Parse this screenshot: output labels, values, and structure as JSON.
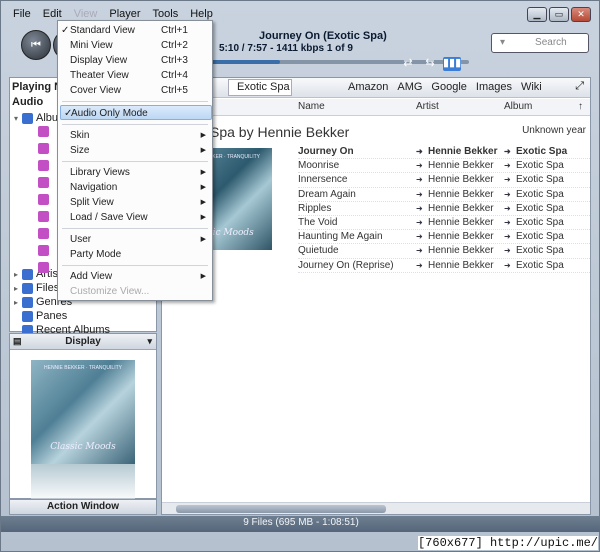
{
  "menubar": {
    "items": [
      "File",
      "Edit",
      "View",
      "Player",
      "Tools",
      "Help"
    ]
  },
  "player": {
    "track": "Journey On (Exotic Spa)",
    "info": "5:10 / 7:57 - 1411 kbps   1 of 9",
    "progress": 0.3
  },
  "search": {
    "placeholder": "Search"
  },
  "left": {
    "playing": "Playing Now",
    "audio": "Audio",
    "tree": [
      "Albums",
      "Artists",
      "Files",
      "Genres",
      "Panes",
      "Recent Albums"
    ]
  },
  "display": {
    "title": "Display"
  },
  "action": {
    "title": "Action Window"
  },
  "toolbar": {
    "combo": "Exotic Spa",
    "links": [
      "Amazon",
      "AMG",
      "Google",
      "Images",
      "Wiki"
    ]
  },
  "columns": {
    "name": "Name",
    "artist": "Artist",
    "album": "Album"
  },
  "album": {
    "title": "Spa by Hennie Bekker",
    "year": "Unknown year",
    "cover_top": "HENNIE BEKKER · TRANQUILITY",
    "cover_name": "Classic Moods"
  },
  "tracks": [
    {
      "name": "Journey On",
      "artist": "Hennie Bekker",
      "album": "Exotic Spa",
      "bold": true
    },
    {
      "name": "Moonrise",
      "artist": "Hennie Bekker",
      "album": "Exotic Spa"
    },
    {
      "name": "Innersence",
      "artist": "Hennie Bekker",
      "album": "Exotic Spa"
    },
    {
      "name": "Dream Again",
      "artist": "Hennie Bekker",
      "album": "Exotic Spa"
    },
    {
      "name": "Ripples",
      "artist": "Hennie Bekker",
      "album": "Exotic Spa"
    },
    {
      "name": "The Void",
      "artist": "Hennie Bekker",
      "album": "Exotic Spa"
    },
    {
      "name": "Haunting Me Again",
      "artist": "Hennie Bekker",
      "album": "Exotic Spa"
    },
    {
      "name": "Quietude",
      "artist": "Hennie Bekker",
      "album": "Exotic Spa"
    },
    {
      "name": "Journey On (Reprise)",
      "artist": "Hennie Bekker",
      "album": "Exotic Spa"
    }
  ],
  "status": "9 Files (695 MB - 1:08:51)",
  "caption": "[760x677] http://upic.me/",
  "viewmenu": {
    "standard": {
      "label": "Standard View",
      "key": "Ctrl+1"
    },
    "mini": {
      "label": "Mini View",
      "key": "Ctrl+2"
    },
    "display": {
      "label": "Display View",
      "key": "Ctrl+3"
    },
    "theater": {
      "label": "Theater View",
      "key": "Ctrl+4"
    },
    "cover": {
      "label": "Cover View",
      "key": "Ctrl+5"
    },
    "audio": "Audio Only Mode",
    "skin": "Skin",
    "size": "Size",
    "library": "Library Views",
    "navigation": "Navigation",
    "split": "Split View",
    "loadsave": "Load / Save View",
    "user": "User",
    "party": "Party Mode",
    "add": "Add View",
    "customize": "Customize View..."
  }
}
